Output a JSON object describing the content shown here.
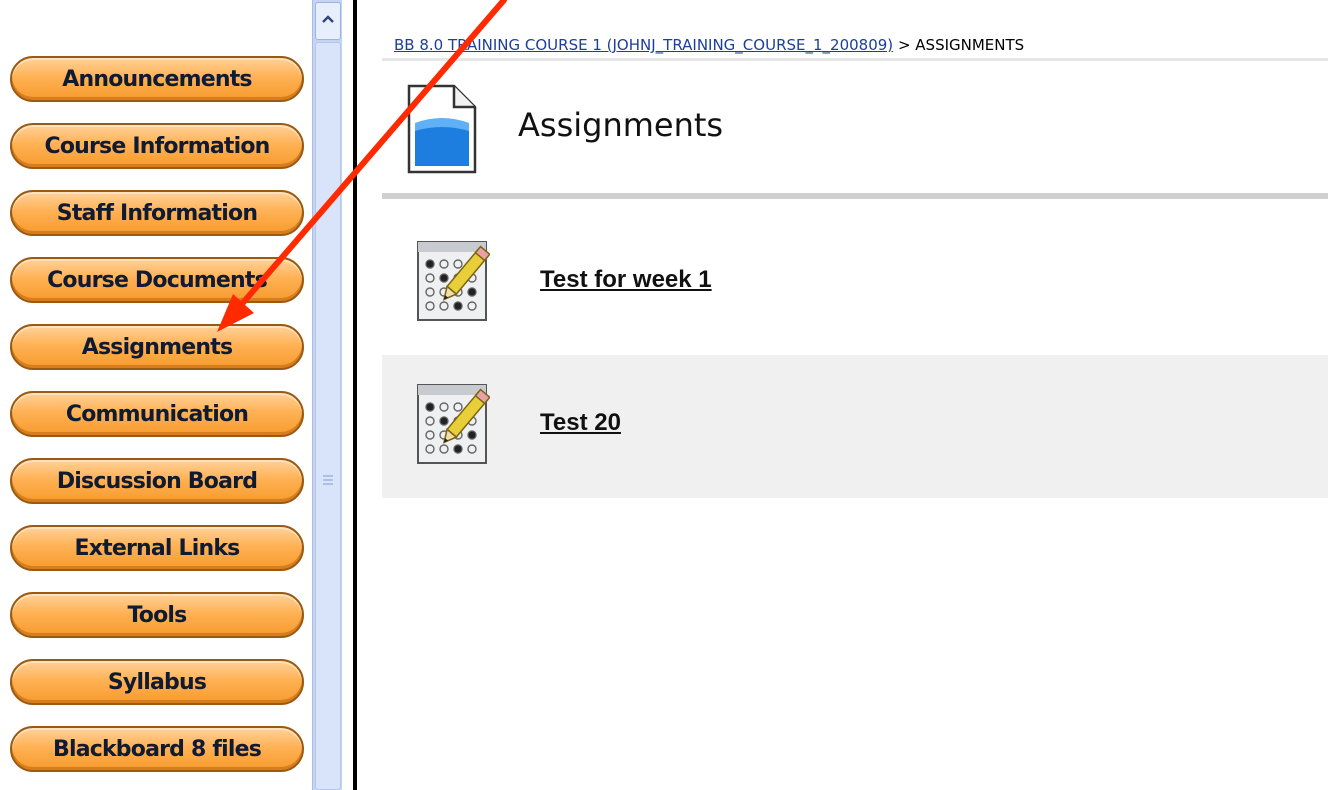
{
  "nav": {
    "items": [
      {
        "label": "Announcements"
      },
      {
        "label": "Course Information"
      },
      {
        "label": "Staff Information"
      },
      {
        "label": "Course Documents"
      },
      {
        "label": "Assignments"
      },
      {
        "label": "Communication"
      },
      {
        "label": "Discussion Board"
      },
      {
        "label": "External Links"
      },
      {
        "label": "Tools"
      },
      {
        "label": "Syllabus"
      },
      {
        "label": "Blackboard 8 files"
      }
    ]
  },
  "breadcrumb": {
    "link": "BB 8.0 TRAINING COURSE 1 (JOHNJ_TRAINING_COURSE_1_200809)",
    "separator": ">",
    "current": "ASSIGNMENTS"
  },
  "page": {
    "title": "Assignments",
    "icon": "document-icon"
  },
  "items": [
    {
      "label": "Test for week 1",
      "icon": "test-icon"
    },
    {
      "label": "Test 20",
      "icon": "test-icon"
    }
  ],
  "colors": {
    "nav_button": "#ffb255",
    "nav_border": "#9a5a12",
    "scrollbar": "#c4d4f3",
    "link": "#1b3f9c",
    "arrow": "#ff2a00"
  }
}
